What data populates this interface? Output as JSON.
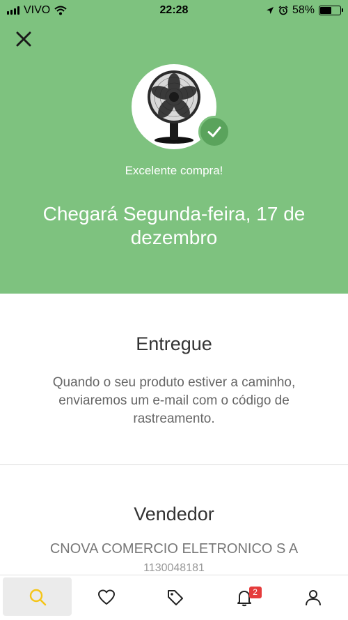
{
  "status_bar": {
    "carrier": "VIVO",
    "time": "22:28",
    "battery": "58%",
    "battery_level": 0.58
  },
  "hero": {
    "subtitle": "Excelente compra!",
    "delivery_date": "Chegará Segunda-feira, 17 de dezembro",
    "background_color": "#7ec27f",
    "product_image": "fan-product-image"
  },
  "delivery": {
    "title": "Entregue",
    "description": "Quando o seu produto estiver a caminho, enviaremos um e-mail com o código de rastreamento."
  },
  "seller": {
    "title": "Vendedor",
    "name": "CNOVA COMERCIO ELETRONICO S A",
    "phone": "1130048181"
  },
  "bottom_nav": {
    "items": [
      {
        "icon": "search-icon",
        "active": true,
        "color": "#f5c518"
      },
      {
        "icon": "heart-icon"
      },
      {
        "icon": "tag-icon"
      },
      {
        "icon": "bell-icon",
        "badge": "2"
      },
      {
        "icon": "user-icon"
      }
    ]
  }
}
